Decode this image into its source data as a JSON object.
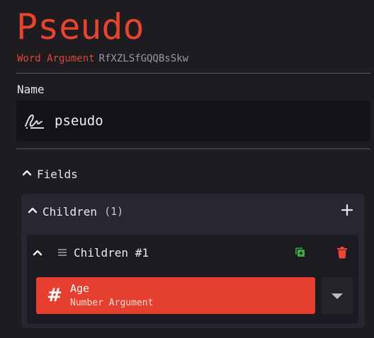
{
  "header": {
    "title": "Pseudo",
    "type_label": "Word Argument",
    "id": "RfXZLSfGQQBsSkw"
  },
  "name_section": {
    "label": "Name",
    "value": "pseudo",
    "icon": "signature-icon"
  },
  "fields_section": {
    "label": "Fields",
    "icon": "chevron-up-icon"
  },
  "children_group": {
    "label": "Children",
    "count": "(1)",
    "add_icon": "plus-icon",
    "items": [
      {
        "label": "Children #1",
        "arguments": [
          {
            "icon": "#",
            "name": "Age",
            "type": "Number Argument"
          }
        ]
      }
    ]
  },
  "colors": {
    "accent": "#e5442f",
    "background": "#1e1b21",
    "panel": "#2a2630",
    "duplicate_icon": "#3fae3f",
    "delete_icon": "#f0473a"
  }
}
